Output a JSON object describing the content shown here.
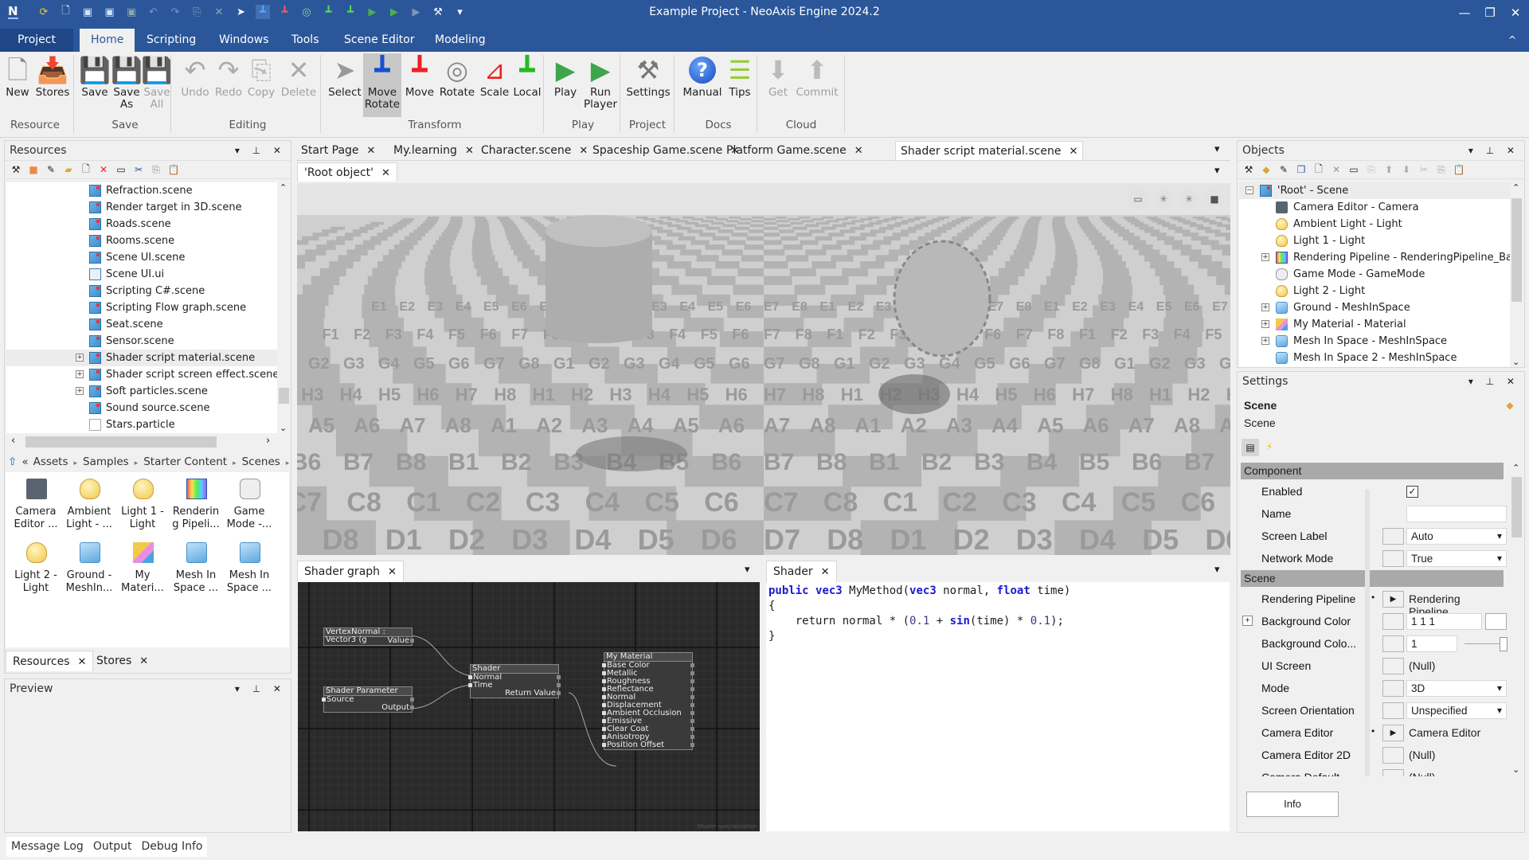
{
  "window": {
    "app_logo": "N",
    "title": "Example Project - NeoAxis Engine 2024.2",
    "controls": {
      "minimize": "—",
      "restore": "❐",
      "close": "✕",
      "collapse_ribbon": "^"
    }
  },
  "quick_access": [
    "refresh-icon",
    "new-icon",
    "save-icon",
    "save-as-icon",
    "save-all-icon",
    "undo-icon",
    "redo-icon",
    "copy-icon",
    "delete-icon",
    "select-icon",
    "move-rotate-icon",
    "move-icon",
    "rotate-icon",
    "scale-icon",
    "local-icon",
    "play-icon",
    "run-player-icon",
    "play-disabled-icon",
    "settings-icon",
    "customize-icon"
  ],
  "menu_tabs": [
    "Project",
    "Home",
    "Scripting",
    "Windows",
    "Tools",
    "Scene Editor",
    "Modeling"
  ],
  "active_menu_tab": "Home",
  "ribbon": {
    "groups": [
      {
        "label": "Resource",
        "buttons": [
          {
            "label": "New",
            "icon": "new-file-icon"
          },
          {
            "label": "Stores",
            "icon": "stores-icon"
          }
        ]
      },
      {
        "label": "Save",
        "buttons": [
          {
            "label": "Save",
            "icon": "save-icon"
          },
          {
            "label": "Save As",
            "line1": "Save",
            "line2": "As",
            "icon": "save-as-icon"
          },
          {
            "label": "Save All",
            "line1": "Save",
            "line2": "All",
            "icon": "save-all-icon",
            "disabled": true
          }
        ]
      },
      {
        "label": "Editing",
        "buttons": [
          {
            "label": "Undo",
            "disabled": true
          },
          {
            "label": "Redo",
            "disabled": true
          },
          {
            "label": "Copy",
            "disabled": true
          },
          {
            "label": "Delete",
            "disabled": true
          }
        ]
      },
      {
        "label": "Transform",
        "buttons": [
          {
            "label": "Select"
          },
          {
            "label": "Move Rotate",
            "line1": "Move",
            "line2": "Rotate",
            "selected": true
          },
          {
            "label": "Move"
          },
          {
            "label": "Rotate"
          },
          {
            "label": "Scale"
          },
          {
            "label": "Local"
          }
        ]
      },
      {
        "label": "Play",
        "buttons": [
          {
            "label": "Play"
          },
          {
            "label": "Run Player",
            "line1": "Run",
            "line2": "Player"
          }
        ]
      },
      {
        "label": "Project",
        "buttons": [
          {
            "label": "Settings"
          }
        ]
      },
      {
        "label": "Docs",
        "buttons": [
          {
            "label": "Manual"
          },
          {
            "label": "Tips"
          }
        ]
      },
      {
        "label": "Cloud",
        "buttons": [
          {
            "label": "Get",
            "disabled": true
          },
          {
            "label": "Commit",
            "disabled": true
          }
        ]
      }
    ]
  },
  "resources": {
    "title": "Resources",
    "header_controls": "▾ ⊥ ✕",
    "files": [
      {
        "name": "Refraction.scene",
        "type": "scene"
      },
      {
        "name": "Render target in 3D.scene",
        "type": "scene"
      },
      {
        "name": "Roads.scene",
        "type": "scene"
      },
      {
        "name": "Rooms.scene",
        "type": "scene"
      },
      {
        "name": "Scene UI.scene",
        "type": "scene"
      },
      {
        "name": "Scene UI.ui",
        "type": "ui"
      },
      {
        "name": "Scripting C#.scene",
        "type": "scene"
      },
      {
        "name": "Scripting Flow graph.scene",
        "type": "scene"
      },
      {
        "name": "Seat.scene",
        "type": "scene"
      },
      {
        "name": "Sensor.scene",
        "type": "scene"
      },
      {
        "name": "Shader script material.scene",
        "type": "scene",
        "expandable": true,
        "selected": true
      },
      {
        "name": "Shader script screen effect.scene",
        "type": "scene",
        "expandable": true
      },
      {
        "name": "Soft particles.scene",
        "type": "scene",
        "expandable": true
      },
      {
        "name": "Sound source.scene",
        "type": "scene"
      },
      {
        "name": "Stars.particle",
        "type": "doc"
      }
    ],
    "breadcrumb": [
      "Assets",
      "Samples",
      "Starter Content",
      "Scenes"
    ],
    "grid_items": [
      {
        "line1": "Camera",
        "line2": "Editor ...",
        "icon": "camera"
      },
      {
        "line1": "Ambient",
        "line2": "Light - ...",
        "icon": "bulb"
      },
      {
        "line1": "Light 1 -",
        "line2": "Light",
        "icon": "bulb"
      },
      {
        "line1": "Renderin",
        "line2": "g Pipeli...",
        "icon": "pipe"
      },
      {
        "line1": "Game",
        "line2": "Mode -...",
        "icon": "pad"
      },
      {
        "line1": "Light 2 -",
        "line2": "Light",
        "icon": "bulb"
      },
      {
        "line1": "Ground -",
        "line2": "MeshIn...",
        "icon": "cube"
      },
      {
        "line1": "My",
        "line2": "Materi...",
        "icon": "mat"
      },
      {
        "line1": "Mesh In",
        "line2": "Space ...",
        "icon": "cube"
      },
      {
        "line1": "Mesh In",
        "line2": "Space ...",
        "icon": "cube"
      }
    ],
    "bottom_tabs": [
      "Resources",
      "Stores"
    ]
  },
  "preview": {
    "title": "Preview"
  },
  "document_tabs": [
    {
      "label": "Start Page"
    },
    {
      "label": "My.learning"
    },
    {
      "label": "Character.scene"
    },
    {
      "label": "Spaceship Game.scene"
    },
    {
      "label": "Platform Game.scene"
    },
    {
      "label": "Shader script material.scene",
      "active": true
    }
  ],
  "sub_tab": "'Root object'",
  "viewport": {
    "toolbar_icons": [
      "display-icon",
      "light-icon",
      "light-icon",
      "camera-icon"
    ],
    "floor_rows": [
      "E",
      "F",
      "G",
      "H",
      "A",
      "B",
      "C",
      "D",
      "E",
      "F"
    ]
  },
  "shader_graph": {
    "title": "Shader graph",
    "watermark": "Shader specialization",
    "nodes": [
      {
        "id": "vn",
        "title": "VertexNormal : Vector3 (g",
        "rows": [
          {
            "text": "Value",
            "align": "right"
          }
        ]
      },
      {
        "id": "sp",
        "title": "Shader Parameter",
        "rows": [
          {
            "text": "Source",
            "align": "left"
          },
          {
            "text": "Output",
            "align": "right"
          }
        ]
      },
      {
        "id": "sh",
        "title": "Shader",
        "rows": [
          {
            "text": "Normal",
            "align": "left"
          },
          {
            "text": "Time",
            "align": "left"
          },
          {
            "text": "Return Value",
            "align": "right"
          }
        ]
      },
      {
        "id": "mm",
        "title": "My Material",
        "rows": [
          {
            "text": "Base Color"
          },
          {
            "text": "Metallic"
          },
          {
            "text": "Roughness"
          },
          {
            "text": "Reflectance"
          },
          {
            "text": "Normal"
          },
          {
            "text": "Displacement"
          },
          {
            "text": "Ambient Occlusion"
          },
          {
            "text": "Emissive"
          },
          {
            "text": "Clear Coat"
          },
          {
            "text": "Anisotropy"
          },
          {
            "text": "Position Offset"
          }
        ]
      }
    ]
  },
  "shader_code": {
    "title": "Shader",
    "lines": [
      [
        {
          "t": "public",
          "c": "kw"
        },
        {
          "t": " "
        },
        {
          "t": "vec3",
          "c": "kw"
        },
        {
          "t": " MyMethod("
        },
        {
          "t": "vec3",
          "c": "kw"
        },
        {
          "t": " normal, "
        },
        {
          "t": "float",
          "c": "kw"
        },
        {
          "t": " time)"
        }
      ],
      [
        {
          "t": "{"
        }
      ],
      [
        {
          "t": "    return normal * ("
        },
        {
          "t": "0.1",
          "c": "num"
        },
        {
          "t": " + "
        },
        {
          "t": "sin",
          "c": "kw"
        },
        {
          "t": "(time) * "
        },
        {
          "t": "0.1",
          "c": "num"
        },
        {
          "t": ");"
        }
      ],
      [
        {
          "t": "}"
        }
      ]
    ]
  },
  "objects": {
    "title": "Objects",
    "tree": [
      {
        "label": "'Root' - Scene",
        "icon": "scene",
        "level": 0,
        "expander": "−"
      },
      {
        "label": "Camera Editor - Camera",
        "icon": "cam",
        "level": 1
      },
      {
        "label": "Ambient Light - Light",
        "icon": "bulb",
        "level": 1
      },
      {
        "label": "Light 1 - Light",
        "icon": "bulb",
        "level": 1
      },
      {
        "label": "Rendering Pipeline - RenderingPipeline_Basic",
        "icon": "pipe",
        "level": 1,
        "expander": "+"
      },
      {
        "label": "Game Mode - GameMode",
        "icon": "pad",
        "level": 1
      },
      {
        "label": "Light 2 - Light",
        "icon": "bulb",
        "level": 1
      },
      {
        "label": "Ground - MeshInSpace",
        "icon": "cube",
        "level": 1,
        "expander": "+"
      },
      {
        "label": "My Material - Material",
        "icon": "mat",
        "level": 1,
        "expander": "+"
      },
      {
        "label": "Mesh In Space - MeshInSpace",
        "icon": "cube",
        "level": 1,
        "expander": "+"
      },
      {
        "label": "Mesh In Space 2 - MeshInSpace",
        "icon": "cube",
        "level": 1
      }
    ]
  },
  "settings": {
    "title": "Settings",
    "object_name": "Scene",
    "object_type": "Scene",
    "categories": [
      {
        "name": "Component",
        "props": [
          {
            "label": "Enabled",
            "kind": "checkbox",
            "value": true
          },
          {
            "label": "Name",
            "kind": "text",
            "value": ""
          },
          {
            "label": "Screen Label",
            "kind": "dropdown",
            "value": "Auto"
          },
          {
            "label": "Network Mode",
            "kind": "dropdown",
            "value": "True"
          }
        ]
      },
      {
        "name": "Scene",
        "props": [
          {
            "label": "Rendering Pipeline",
            "kind": "ref",
            "value": "Rendering Pipeline"
          },
          {
            "label": "Background Color",
            "kind": "color",
            "value": "1 1 1",
            "expander": "+"
          },
          {
            "label": "Background Colo...",
            "kind": "slider",
            "value": "1",
            "slider_fraction": 1.0
          },
          {
            "label": "UI Screen",
            "kind": "plain",
            "value": "(Null)"
          },
          {
            "label": "Mode",
            "kind": "dropdown",
            "value": "3D"
          },
          {
            "label": "Screen Orientation",
            "kind": "dropdown",
            "value": "Unspecified"
          },
          {
            "label": "Camera Editor",
            "kind": "ref",
            "value": "Camera Editor"
          },
          {
            "label": "Camera Editor 2D",
            "kind": "plain",
            "value": "(Null)"
          },
          {
            "label": "Camera Default",
            "kind": "plain",
            "value": "(Null)"
          }
        ]
      }
    ],
    "info_button": "Info"
  },
  "bottom_bar": [
    "Message Log",
    "Output",
    "Debug Info"
  ],
  "colors": {
    "brand": "#2b579a",
    "graph_bg": "#2a2a2a",
    "keyword": "#1a1ad0"
  }
}
